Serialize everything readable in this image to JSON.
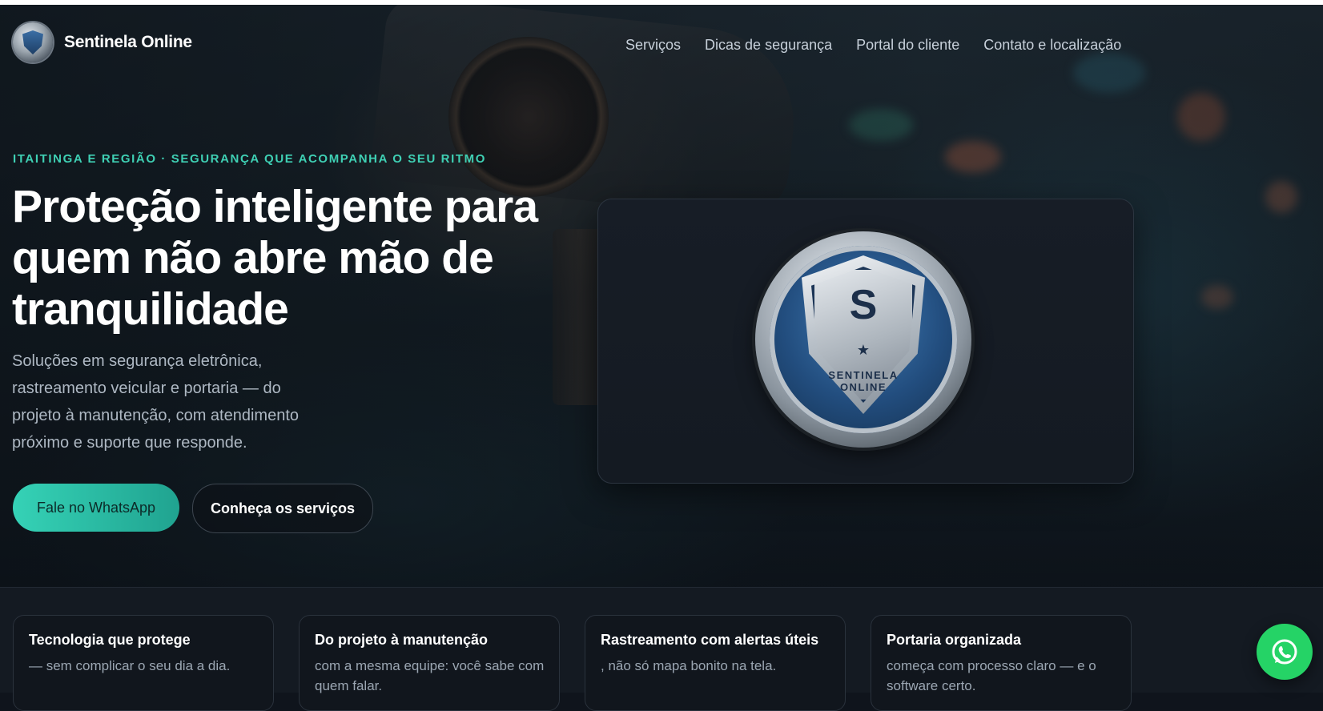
{
  "brand": {
    "name": "Sentinela Online",
    "logo_icon": "shield-emblem-icon"
  },
  "nav": {
    "items": [
      {
        "label": "Serviços"
      },
      {
        "label": "Dicas de segurança"
      },
      {
        "label": "Portal do cliente"
      },
      {
        "label": "Contato e localização"
      }
    ]
  },
  "hero": {
    "eyebrow": "ITAITINGA E REGIÃO · SEGURANÇA QUE ACOMPANHA O SEU RITMO",
    "headline": "Proteção inteligente para quem não abre mão de tranquilidade",
    "lead": "Soluções em segurança eletrônica, rastreamento veicular e portaria — do projeto à manutenção, com atendimento próximo e suporte que responde.",
    "primary_cta": "Fale no WhatsApp",
    "secondary_cta": "Conheça os serviços",
    "emblem": {
      "text": "SENTINELA ONLINE",
      "monogram": "S"
    }
  },
  "features": [
    {
      "title": "Tecnologia que protege",
      "text": "— sem complicar o seu dia a dia."
    },
    {
      "title": "Do projeto à manutenção",
      "text": "com a mesma equipe: você sabe com quem falar."
    },
    {
      "title": "Rastreamento com alertas úteis",
      "text": ", não só mapa bonito na tela."
    },
    {
      "title": "Portaria organizada",
      "text": "começa com processo claro — e o software certo."
    }
  ],
  "whatsapp_fab": {
    "icon": "whatsapp-icon"
  },
  "colors": {
    "accent": "#35d2b6",
    "whatsapp": "#25d366",
    "background": "#0f141c"
  }
}
